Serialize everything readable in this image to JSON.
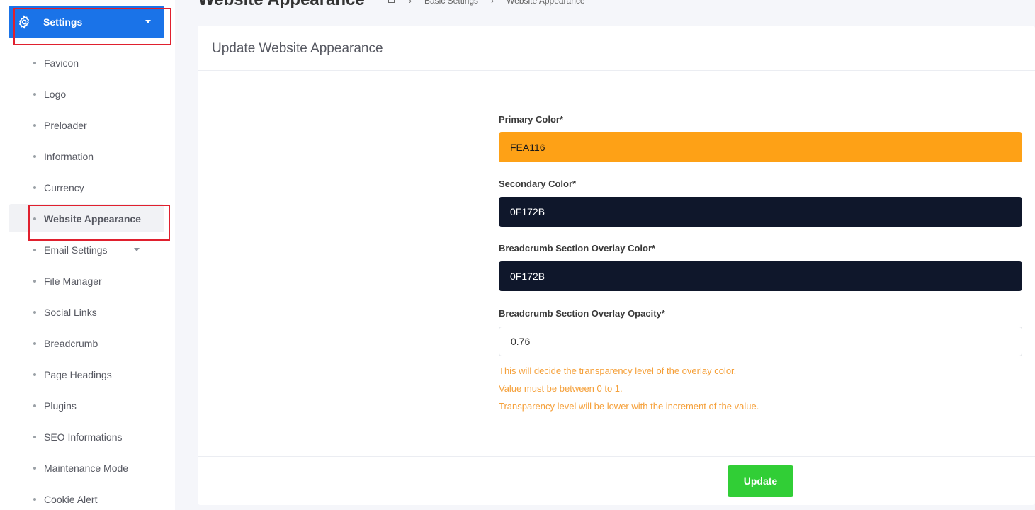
{
  "sidebar": {
    "settings_label": "Settings",
    "items": [
      {
        "label": "Favicon"
      },
      {
        "label": "Logo"
      },
      {
        "label": "Preloader"
      },
      {
        "label": "Information"
      },
      {
        "label": "Currency"
      },
      {
        "label": "Website Appearance",
        "active": true
      },
      {
        "label": "Email Settings",
        "has_submenu": true
      },
      {
        "label": "File Manager"
      },
      {
        "label": "Social Links"
      },
      {
        "label": "Breadcrumb"
      },
      {
        "label": "Page Headings"
      },
      {
        "label": "Plugins"
      },
      {
        "label": "SEO Informations"
      },
      {
        "label": "Maintenance Mode"
      },
      {
        "label": "Cookie Alert"
      }
    ]
  },
  "header": {
    "title": "Website Appearance",
    "breadcrumb": [
      "home-icon",
      "Basic Settings",
      "Website Appearance"
    ]
  },
  "card": {
    "title": "Update Website Appearance",
    "fields": {
      "primary_color": {
        "label": "Primary Color*",
        "value": "FEA116"
      },
      "secondary_color": {
        "label": "Secondary Color*",
        "value": "0F172B"
      },
      "overlay_color": {
        "label": "Breadcrumb Section Overlay Color*",
        "value": "0F172B"
      },
      "overlay_opacity": {
        "label": "Breadcrumb Section Overlay Opacity*",
        "value": "0.76"
      }
    },
    "help": [
      "This will decide the transparency level of the overlay color.",
      "Value must be between 0 to 1.",
      "Transparency level will be lower with the increment of the value."
    ],
    "update_label": "Update"
  },
  "colors": {
    "primary": "#FEA116",
    "secondary": "#0F172B",
    "settings_button": "#1A73E8",
    "update_button": "#31CE36",
    "help_text": "#F5A03A",
    "annotation_box": "#E0202E"
  }
}
